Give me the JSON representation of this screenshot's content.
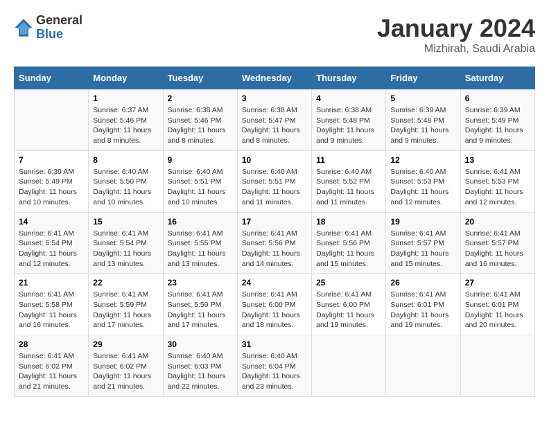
{
  "logo": {
    "general": "General",
    "blue": "Blue"
  },
  "title": "January 2024",
  "location": "Mizhirah, Saudi Arabia",
  "days_of_week": [
    "Sunday",
    "Monday",
    "Tuesday",
    "Wednesday",
    "Thursday",
    "Friday",
    "Saturday"
  ],
  "weeks": [
    [
      {
        "day": "",
        "info": ""
      },
      {
        "day": "1",
        "info": "Sunrise: 6:37 AM\nSunset: 5:46 PM\nDaylight: 11 hours\nand 8 minutes."
      },
      {
        "day": "2",
        "info": "Sunrise: 6:38 AM\nSunset: 5:46 PM\nDaylight: 11 hours\nand 8 minutes."
      },
      {
        "day": "3",
        "info": "Sunrise: 6:38 AM\nSunset: 5:47 PM\nDaylight: 11 hours\nand 8 minutes."
      },
      {
        "day": "4",
        "info": "Sunrise: 6:38 AM\nSunset: 5:48 PM\nDaylight: 11 hours\nand 9 minutes."
      },
      {
        "day": "5",
        "info": "Sunrise: 6:39 AM\nSunset: 5:48 PM\nDaylight: 11 hours\nand 9 minutes."
      },
      {
        "day": "6",
        "info": "Sunrise: 6:39 AM\nSunset: 5:49 PM\nDaylight: 11 hours\nand 9 minutes."
      }
    ],
    [
      {
        "day": "7",
        "info": "Sunrise: 6:39 AM\nSunset: 5:49 PM\nDaylight: 11 hours\nand 10 minutes."
      },
      {
        "day": "8",
        "info": "Sunrise: 6:40 AM\nSunset: 5:50 PM\nDaylight: 11 hours\nand 10 minutes."
      },
      {
        "day": "9",
        "info": "Sunrise: 6:40 AM\nSunset: 5:51 PM\nDaylight: 11 hours\nand 10 minutes."
      },
      {
        "day": "10",
        "info": "Sunrise: 6:40 AM\nSunset: 5:51 PM\nDaylight: 11 hours\nand 11 minutes."
      },
      {
        "day": "11",
        "info": "Sunrise: 6:40 AM\nSunset: 5:52 PM\nDaylight: 11 hours\nand 11 minutes."
      },
      {
        "day": "12",
        "info": "Sunrise: 6:40 AM\nSunset: 5:53 PM\nDaylight: 11 hours\nand 12 minutes."
      },
      {
        "day": "13",
        "info": "Sunrise: 6:41 AM\nSunset: 5:53 PM\nDaylight: 11 hours\nand 12 minutes."
      }
    ],
    [
      {
        "day": "14",
        "info": "Sunrise: 6:41 AM\nSunset: 5:54 PM\nDaylight: 11 hours\nand 12 minutes."
      },
      {
        "day": "15",
        "info": "Sunrise: 6:41 AM\nSunset: 5:54 PM\nDaylight: 11 hours\nand 13 minutes."
      },
      {
        "day": "16",
        "info": "Sunrise: 6:41 AM\nSunset: 5:55 PM\nDaylight: 11 hours\nand 13 minutes."
      },
      {
        "day": "17",
        "info": "Sunrise: 6:41 AM\nSunset: 5:56 PM\nDaylight: 11 hours\nand 14 minutes."
      },
      {
        "day": "18",
        "info": "Sunrise: 6:41 AM\nSunset: 5:56 PM\nDaylight: 11 hours\nand 15 minutes."
      },
      {
        "day": "19",
        "info": "Sunrise: 6:41 AM\nSunset: 5:57 PM\nDaylight: 11 hours\nand 15 minutes."
      },
      {
        "day": "20",
        "info": "Sunrise: 6:41 AM\nSunset: 5:57 PM\nDaylight: 11 hours\nand 16 minutes."
      }
    ],
    [
      {
        "day": "21",
        "info": "Sunrise: 6:41 AM\nSunset: 5:58 PM\nDaylight: 11 hours\nand 16 minutes."
      },
      {
        "day": "22",
        "info": "Sunrise: 6:41 AM\nSunset: 5:59 PM\nDaylight: 11 hours\nand 17 minutes."
      },
      {
        "day": "23",
        "info": "Sunrise: 6:41 AM\nSunset: 5:59 PM\nDaylight: 11 hours\nand 17 minutes."
      },
      {
        "day": "24",
        "info": "Sunrise: 6:41 AM\nSunset: 6:00 PM\nDaylight: 11 hours\nand 18 minutes."
      },
      {
        "day": "25",
        "info": "Sunrise: 6:41 AM\nSunset: 6:00 PM\nDaylight: 11 hours\nand 19 minutes."
      },
      {
        "day": "26",
        "info": "Sunrise: 6:41 AM\nSunset: 6:01 PM\nDaylight: 11 hours\nand 19 minutes."
      },
      {
        "day": "27",
        "info": "Sunrise: 6:41 AM\nSunset: 6:01 PM\nDaylight: 11 hours\nand 20 minutes."
      }
    ],
    [
      {
        "day": "28",
        "info": "Sunrise: 6:41 AM\nSunset: 6:02 PM\nDaylight: 11 hours\nand 21 minutes."
      },
      {
        "day": "29",
        "info": "Sunrise: 6:41 AM\nSunset: 6:02 PM\nDaylight: 11 hours\nand 21 minutes."
      },
      {
        "day": "30",
        "info": "Sunrise: 6:40 AM\nSunset: 6:03 PM\nDaylight: 11 hours\nand 22 minutes."
      },
      {
        "day": "31",
        "info": "Sunrise: 6:40 AM\nSunset: 6:04 PM\nDaylight: 11 hours\nand 23 minutes."
      },
      {
        "day": "",
        "info": ""
      },
      {
        "day": "",
        "info": ""
      },
      {
        "day": "",
        "info": ""
      }
    ]
  ]
}
